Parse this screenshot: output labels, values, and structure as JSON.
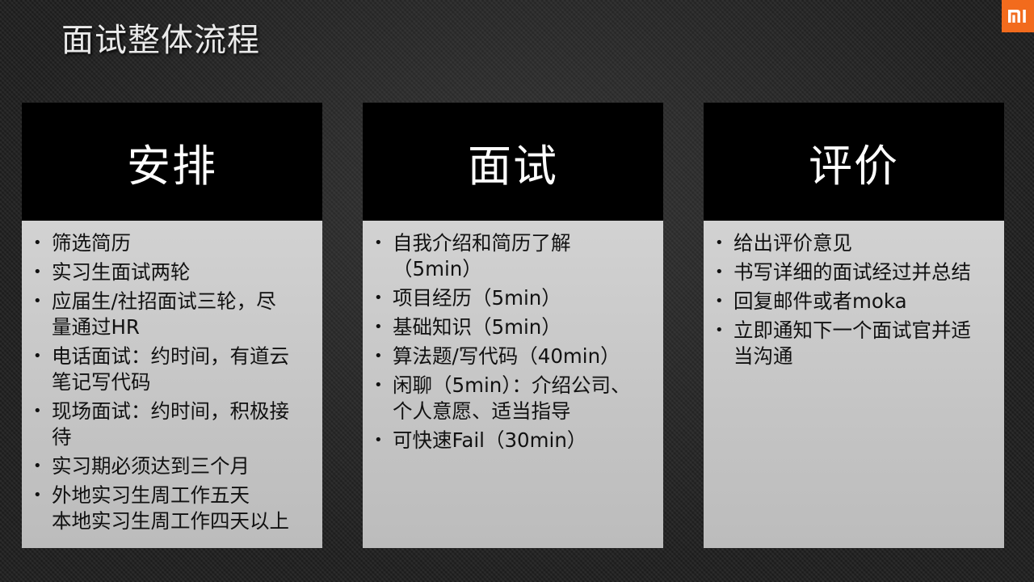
{
  "slide": {
    "title": "面试整体流程"
  },
  "brand": {
    "logo_icon": "mi-logo-icon",
    "accent_color": "#f26b1d"
  },
  "columns": [
    {
      "heading": "安排",
      "items": [
        "筛选简历",
        "实习生面试两轮",
        "应届生/社招面试三轮，尽\n量通过HR",
        "电话面试：约时间，有道云\n笔记写代码",
        "现场面试：约时间，积极接\n待",
        "实习期必须达到三个月",
        "外地实习生周工作五天\n本地实习生周工作四天以上"
      ]
    },
    {
      "heading": "面试",
      "items": [
        "自我介绍和简历了解\n（5min）",
        "项目经历（5min）",
        "基础知识（5min）",
        "算法题/写代码（40min）",
        "闲聊（5min）：介绍公司、\n个人意愿、适当指导",
        "可快速Fail（30min）"
      ]
    },
    {
      "heading": "评价",
      "items": [
        "给出评价意见",
        "书写详细的面试经过并总结",
        "回复邮件或者moka",
        "立即通知下一个面试官并适\n当沟通"
      ]
    }
  ]
}
